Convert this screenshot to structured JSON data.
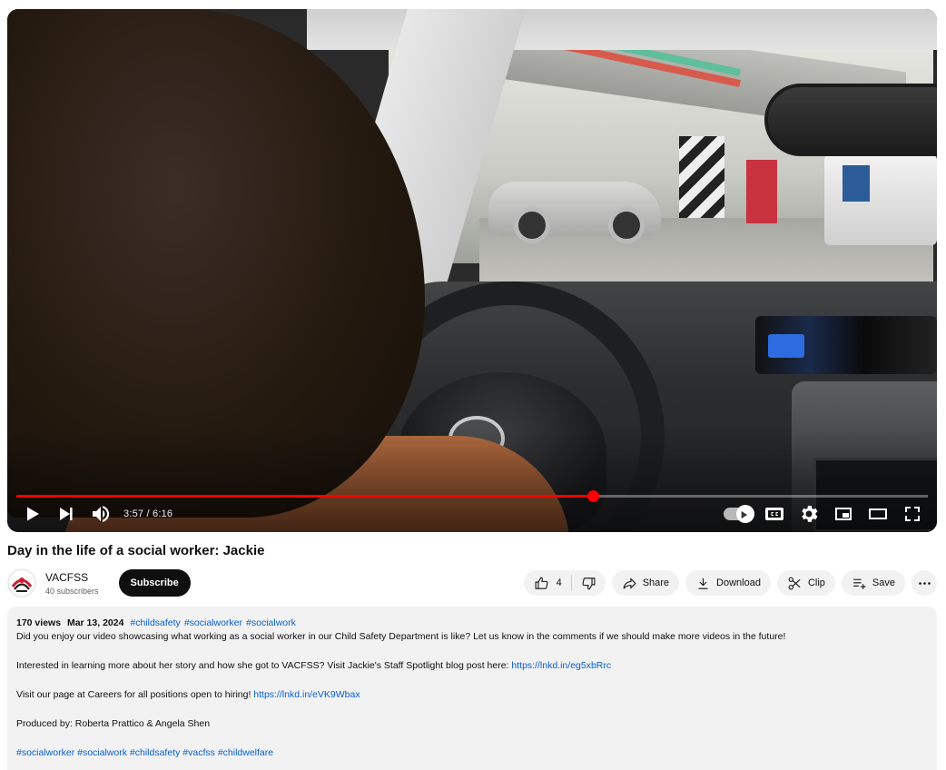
{
  "player": {
    "current_time": "3:57",
    "duration": "6:16",
    "time_separator": " / ",
    "progress": 0.632
  },
  "video": {
    "title": "Day in the life of a social worker: Jackie"
  },
  "channel": {
    "name": "VACFSS",
    "subscribers": "40 subscribers",
    "subscribe_label": "Subscribe"
  },
  "actions": {
    "like_count": "4",
    "share_label": "Share",
    "download_label": "Download",
    "clip_label": "Clip",
    "save_label": "Save"
  },
  "description": {
    "views": "170 views",
    "date": "Mar 13, 2024",
    "meta_tags": [
      "#childsafety",
      "#socialworker",
      "#socialwork"
    ],
    "line1": "Did you enjoy our video showcasing what working as a social worker in our Child Safety Department is like?  Let us know in the comments if we should make more videos in the future!",
    "line2_text": "Interested in learning more about her story and how she got to VACFSS? Visit Jackie's Staff Spotlight blog post here: ",
    "line2_link": "https://lnkd.in/eg5xbRrc",
    "line3_text": "Visit our page at Careers for all positions open to hiring! ",
    "line3_link": "https://lnkd.in/eVK9Wbax",
    "line4": "Produced by: Roberta Prattico & Angela Shen",
    "footer_tags": [
      "#socialworker",
      "#socialwork",
      "#childsafety",
      "#vacfss",
      "#childwelfare"
    ]
  },
  "colors": {
    "accent_red": "#ff0000",
    "link_blue": "#065fd4",
    "pill_bg": "#f2f2f2"
  }
}
